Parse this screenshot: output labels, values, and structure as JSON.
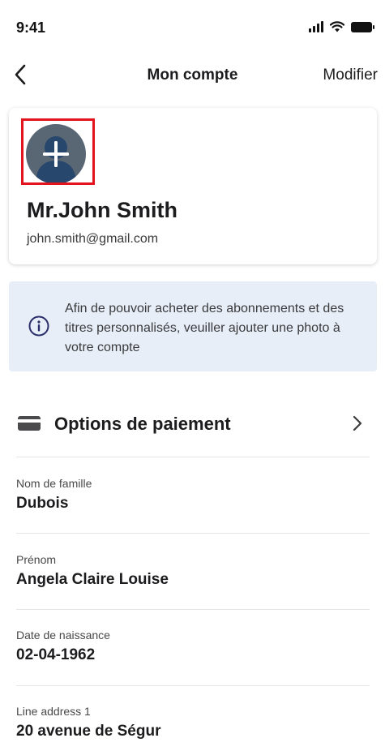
{
  "status_bar": {
    "time": "9:41"
  },
  "nav": {
    "title": "Mon compte",
    "edit_label": "Modifier"
  },
  "profile": {
    "name": "Mr.John Smith",
    "email": "john.smith@gmail.com"
  },
  "info_banner": {
    "text": "Afin de pouvoir acheter des abonnements et des titres personnalisés, veuiller ajouter une photo à votre compte"
  },
  "payment": {
    "label": "Options de paiement"
  },
  "fields": [
    {
      "label": "Nom de famille",
      "value": "Dubois"
    },
    {
      "label": "Prénom",
      "value": "Angela Claire Louise"
    },
    {
      "label": "Date de naissance",
      "value": "02-04-1962"
    },
    {
      "label": "Line address 1",
      "value": "20 avenue de Ségur"
    }
  ],
  "colors": {
    "highlight": "#e3141d",
    "banner_background": "#e7eef7",
    "avatar_background": "#596673",
    "info_icon": "#2b2f6b"
  },
  "icons": [
    "signal-icon",
    "wifi-icon",
    "battery-icon",
    "back-chevron-icon",
    "person-icon",
    "plus-icon",
    "info-icon",
    "credit-card-icon",
    "chevron-right-icon"
  ]
}
